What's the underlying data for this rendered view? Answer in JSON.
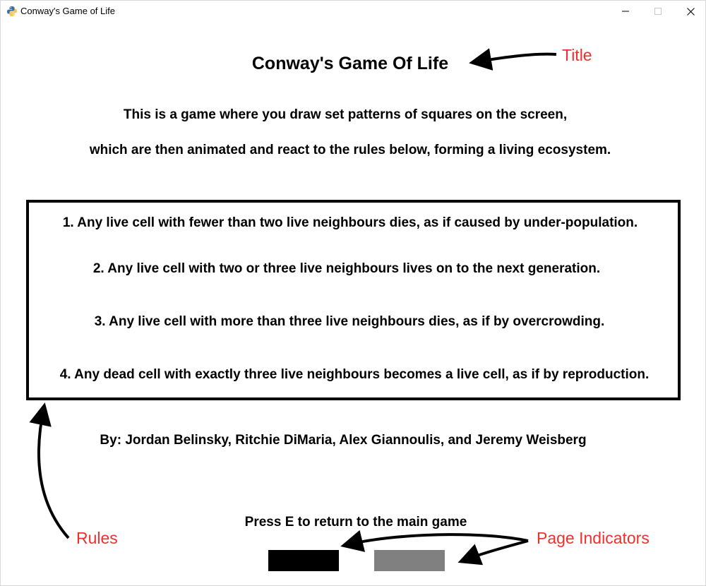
{
  "window": {
    "title": "Conway's Game of Life",
    "icon": "python-icon",
    "controls": [
      "minimize-icon",
      "maximize-icon",
      "close-icon"
    ]
  },
  "content": {
    "title": "Conway's Game Of Life",
    "intro_line_1": "This is a game where you draw set patterns of squares on the screen,",
    "intro_line_2": "which are then animated and react to the rules below, forming a living ecosystem.",
    "rules": [
      "1. Any live cell with fewer than two live neighbours dies, as if caused by under-population.",
      "2. Any live cell with two or three live neighbours lives on to the next generation.",
      "3. Any live cell with more than three live neighbours dies, as if by overcrowding.",
      "4. Any dead cell with exactly three live neighbours becomes a live cell, as if by reproduction."
    ],
    "credits": "By: Jordan Belinsky, Ritchie DiMaria, Alex Giannoulis, and Jeremy Weisberg",
    "press_hint": "Press E to return to the main game"
  },
  "page_indicators": {
    "count": 2,
    "current": 1,
    "active_color": "#000000",
    "inactive_color": "#808080"
  },
  "annotations": {
    "title_label": "Title",
    "rules_label": "Rules",
    "page_indicators_label": "Page Indicators",
    "color": "#f0302c"
  }
}
